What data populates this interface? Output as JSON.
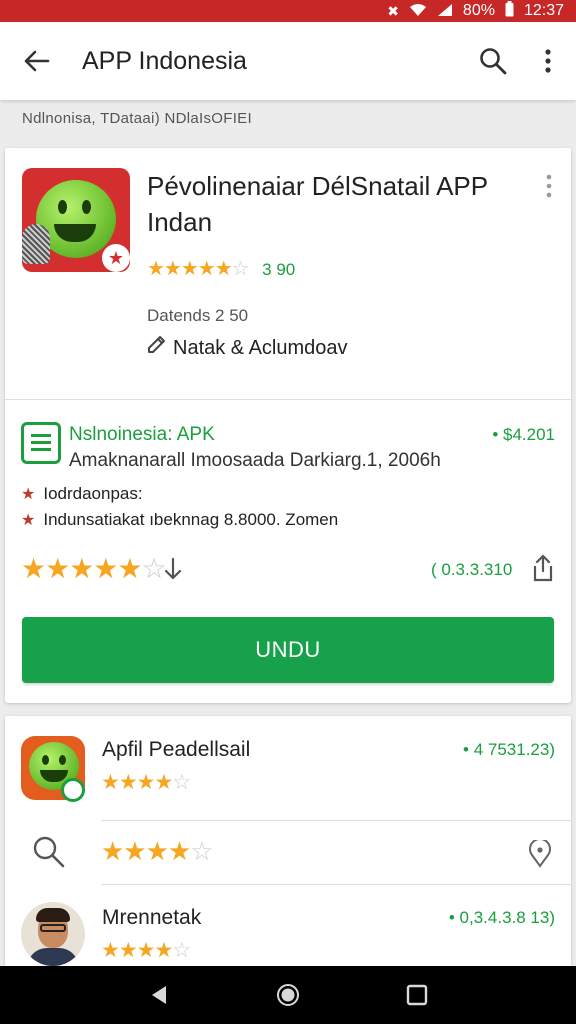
{
  "status_bar": {
    "battery": "80%",
    "time": "12:37"
  },
  "app_bar": {
    "title": "APP Indonesia"
  },
  "breadcrumb": "Ndlnonisa,  TDataai)  NDlaIsOFIEI",
  "featured": {
    "title": "Pévolinenaiar DélSnatail APP Indan",
    "stars": {
      "full": "★★★★",
      "partial": "★",
      "empty": "☆"
    },
    "rating": "3 90",
    "date": "Datends 2 50",
    "tag": "Natak & Aclumdoav",
    "tag_icon": "pencil-icon"
  },
  "apk": {
    "name": "Nslnoinesia: APK",
    "price": "• $4.201",
    "description": "Amaknanarall Imoosaada Darkiarg.1, 2006h",
    "info_label": "Iodrdaonpas:",
    "info_detail": "Indunsatiakat ıbeknnag 8.8000. Zomen",
    "big_stars": {
      "full": "★★★★★",
      "empty": "☆"
    },
    "downloads": "( 0.3.3.310",
    "install_label": "UNDU"
  },
  "related": [
    {
      "name": "Apfil Peadellsail",
      "price": "• 4 7531.23)",
      "stars": {
        "full": "★★★★",
        "empty": "☆"
      }
    },
    {
      "stars": {
        "full": "★★★★",
        "empty": "☆"
      }
    },
    {
      "name": "Mrennetak",
      "price": "• 0,3.4.3.8 13)",
      "stars": {
        "full": "★★★★",
        "empty": "☆"
      }
    }
  ],
  "colors": {
    "status": "#c62828",
    "accent": "#17a14a",
    "star": "#f5a623"
  }
}
